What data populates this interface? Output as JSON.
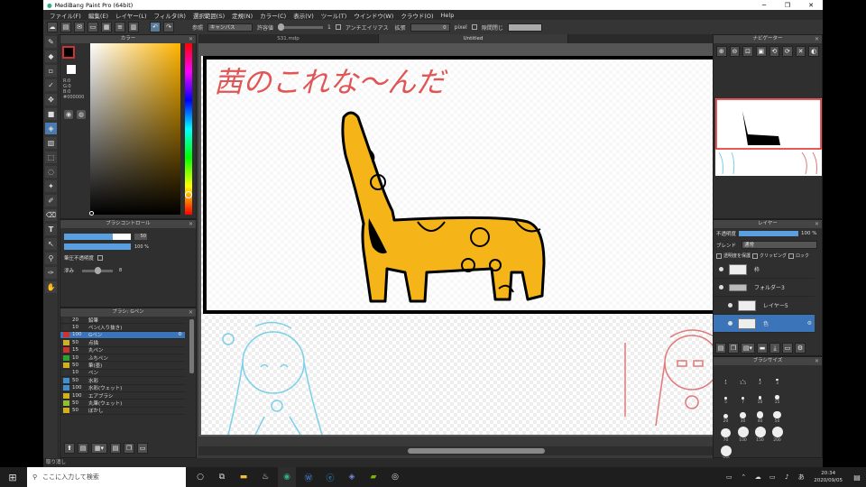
{
  "window": {
    "title": "MediBang Paint Pro (64bit)"
  },
  "menu": [
    "ファイル(F)",
    "編集(E)",
    "レイヤー(L)",
    "フィルタ(R)",
    "選択範囲(S)",
    "定規(N)",
    "カラー(C)",
    "表示(V)",
    "ツール(T)",
    "ウインドウ(W)",
    "クラウド(O)",
    "Help"
  ],
  "toolbar": {
    "ref_label": "参照",
    "ref_value": "キャンバス",
    "tolerance_label": "許容値",
    "tolerance_value": "1",
    "antialias_label": "アンチエイリアス",
    "expand_label": "拡張",
    "expand_value": "0",
    "expand_unit": "pixel",
    "gap_label": "隙間閉じ"
  },
  "color_panel": {
    "title": "カラー",
    "r": "R:0",
    "g": "G:0",
    "b": "B:0",
    "hex": "#000000",
    "fg": "#000000",
    "bg": "#ffffff"
  },
  "brush_control": {
    "title": "ブラシコントロール",
    "size": "50",
    "opacity": "100 %",
    "pressure_label": "筆圧不透明度",
    "blur_label": "滲み",
    "blur_value": "8"
  },
  "brush_panel": {
    "title": "ブラシ: Gペン",
    "items": [
      {
        "size": "20",
        "name": "鉛筆",
        "color": "#333333"
      },
      {
        "size": "10",
        "name": "ペン(入り抜き)",
        "color": "#333333"
      },
      {
        "size": "100",
        "name": "Gペン",
        "color": "#d03030"
      },
      {
        "size": "50",
        "name": "点描",
        "color": "#d0b020"
      },
      {
        "size": "15",
        "name": "丸ペン",
        "color": "#d03030"
      },
      {
        "size": "10",
        "name": "ふちペン",
        "color": "#30a030"
      },
      {
        "size": "50",
        "name": "筆(墨)",
        "color": "#d0b020"
      },
      {
        "size": "10",
        "name": "ペン",
        "color": "#333333"
      },
      {
        "size": "50",
        "name": "水彩",
        "color": "#4090d0"
      },
      {
        "size": "100",
        "name": "水彩(ウェット)",
        "color": "#4090d0"
      },
      {
        "size": "100",
        "name": "エアブラシ",
        "color": "#d0b020"
      },
      {
        "size": "50",
        "name": "丸筆(ウェット)",
        "color": "#90c030"
      },
      {
        "size": "50",
        "name": "ぼかし",
        "color": "#d0b020"
      }
    ],
    "selected_index": 2
  },
  "document_tabs": [
    "S31.mdp",
    "Untitled"
  ],
  "canvas_text": "茜のこれな〜んだ",
  "navigator": {
    "title": "ナビゲーター"
  },
  "layer_panel": {
    "title": "レイヤー",
    "opacity_label": "不透明度",
    "opacity_value": "100 %",
    "blend_label": "ブレンド",
    "blend_value": "通常",
    "protect_label": "透明度を保護",
    "clip_label": "クリッピング",
    "lock_label": "ロック",
    "layers": [
      {
        "name": "枠",
        "indent": false
      },
      {
        "name": "フォルダー3",
        "indent": false,
        "folder": true
      },
      {
        "name": "レイヤー5",
        "indent": true
      },
      {
        "name": "色",
        "indent": true
      }
    ],
    "selected_index": 3
  },
  "brush_size_panel": {
    "title": "ブラシサイズ",
    "sizes": [
      "1",
      "1.5",
      "2",
      "3",
      "5",
      "7",
      "10",
      "15",
      "20",
      "30",
      "40",
      "50",
      "70",
      "100",
      "150",
      "200",
      "300"
    ]
  },
  "statusbar": "取り消し",
  "taskbar": {
    "search_placeholder": "ここに入力して検索",
    "time": "20:34",
    "date": "2020/09/05"
  }
}
